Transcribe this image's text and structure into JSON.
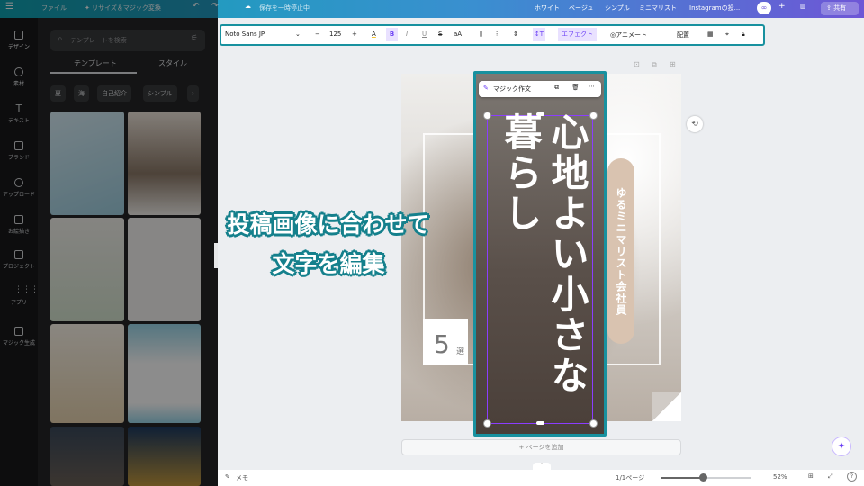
{
  "topbar": {
    "file": "ファイル",
    "resize": "✦ リサイズ＆マジック変換",
    "saving": "保存を一時停止中",
    "doc_tags": [
      "ホワイト",
      "ベージュ",
      "シンプル",
      "ミニマリスト",
      "Instagramの投..."
    ],
    "share": "共有"
  },
  "left_rail": [
    {
      "label": "デザイン",
      "icon": "design-icon"
    },
    {
      "label": "素材",
      "icon": "elements-icon"
    },
    {
      "label": "テキスト",
      "icon": "text-icon"
    },
    {
      "label": "ブランド",
      "icon": "brand-icon"
    },
    {
      "label": "アップロード",
      "icon": "upload-icon"
    },
    {
      "label": "お絵描き",
      "icon": "draw-icon"
    },
    {
      "label": "プロジェクト",
      "icon": "folder-icon"
    },
    {
      "label": "アプリ",
      "icon": "apps-icon"
    },
    {
      "label": "マジック生成",
      "icon": "magic-generate-icon"
    }
  ],
  "panel": {
    "search_placeholder": "テンプレートを検索",
    "tab_templates": "テンプレート",
    "tab_styles": "スタイル",
    "chips": [
      "夏",
      "海",
      "自己紹介",
      "シンプル"
    ]
  },
  "toolbar": {
    "font": "Noto Sans JP",
    "size": "125",
    "minus": "−",
    "plus": "+",
    "bold": "B",
    "italic": "I",
    "underline": "U",
    "strike": "S",
    "case": "aA",
    "effects": "エフェクト",
    "animate": "アニメート",
    "position": "配置"
  },
  "context_menu": {
    "magic_write": "マジック作文"
  },
  "design": {
    "title_text": "心地よい小さな暮らし",
    "pill_text": "ゆるミニマリスト会社員",
    "number": "5",
    "number_suffix": "選"
  },
  "caption": {
    "line1": "投稿画像に合わせて",
    "line2": "文字を編集"
  },
  "bottom": {
    "notes": "メモ",
    "pages": "1/1ページ",
    "zoom": "52%",
    "add_page": "+ ページを追加"
  }
}
